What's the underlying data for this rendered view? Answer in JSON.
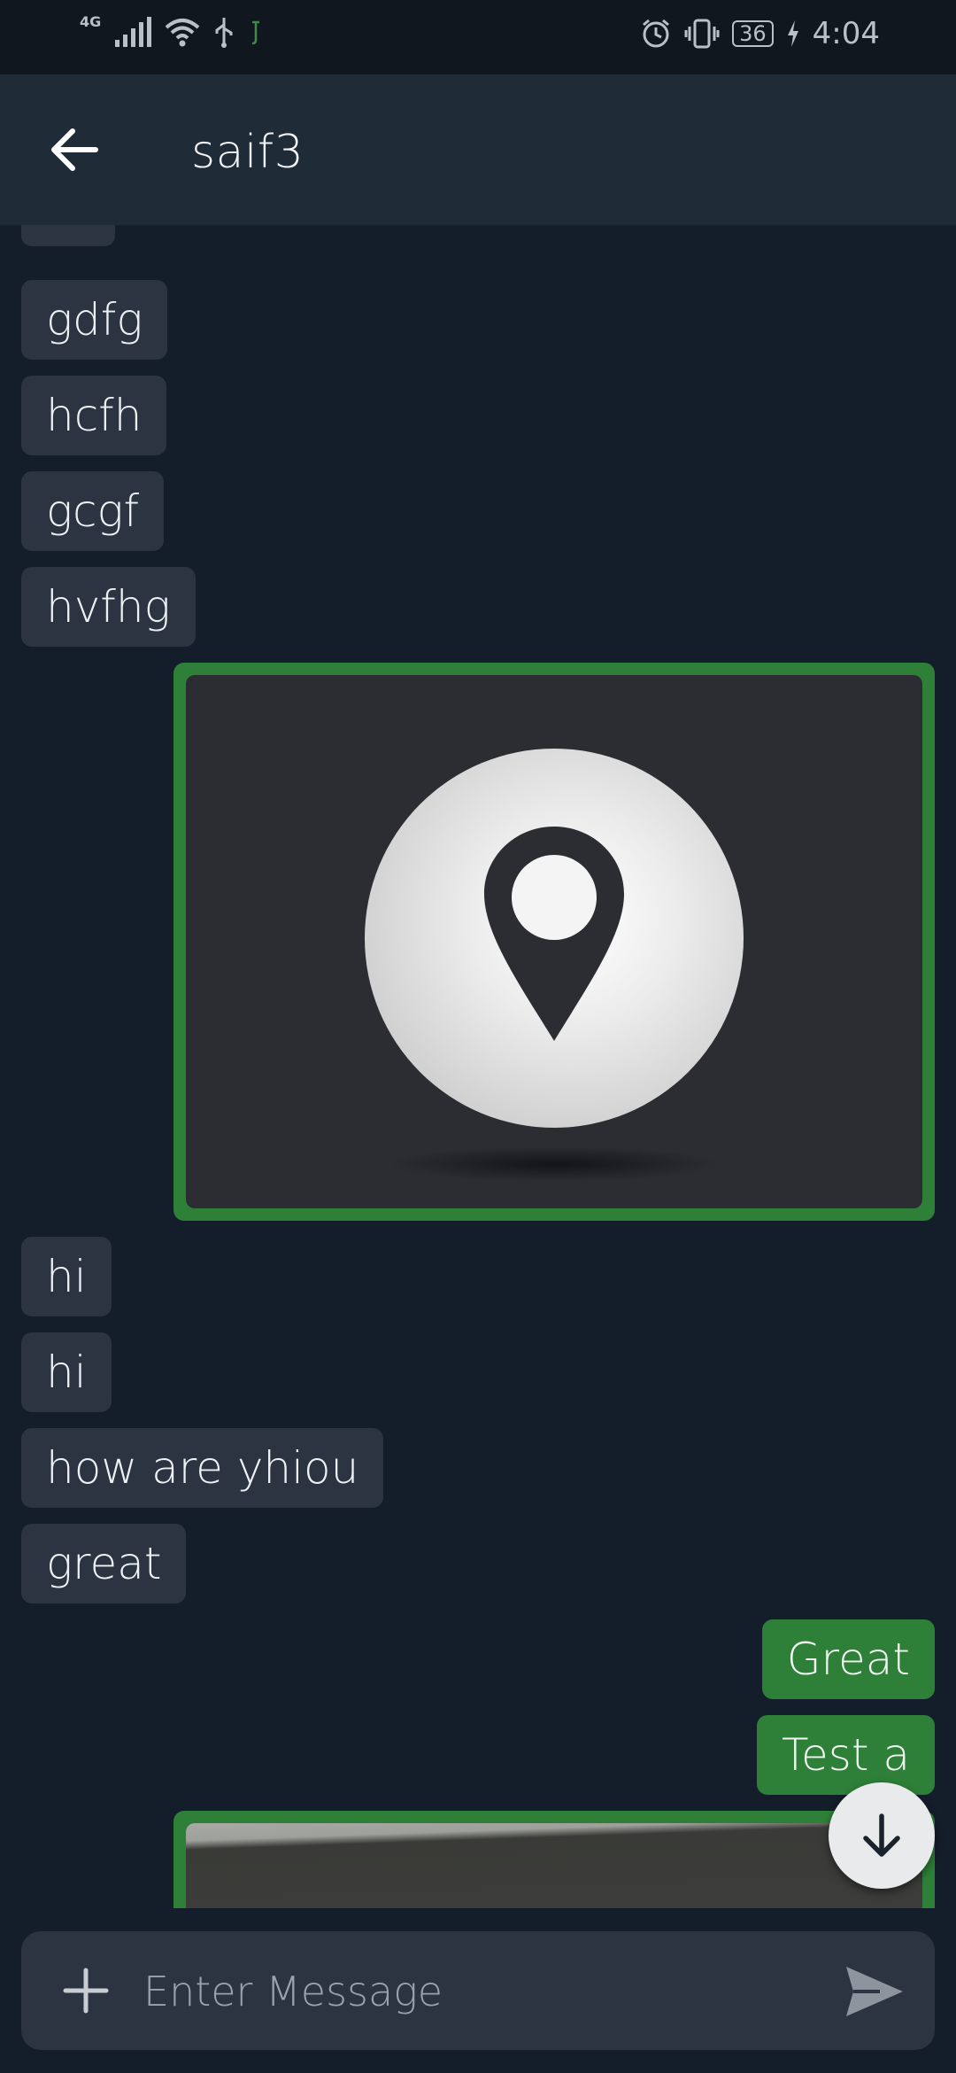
{
  "status_bar": {
    "network": "4G",
    "battery": "36",
    "time": "4:04"
  },
  "header": {
    "title": "saif3"
  },
  "messages": [
    {
      "type": "text",
      "direction": "received",
      "text": "gdfg"
    },
    {
      "type": "text",
      "direction": "received",
      "text": "hcfh"
    },
    {
      "type": "text",
      "direction": "received",
      "text": "gcgf"
    },
    {
      "type": "text",
      "direction": "received",
      "text": "hvfhg"
    },
    {
      "type": "location",
      "direction": "sent",
      "icon": "map-pin-icon"
    },
    {
      "type": "text",
      "direction": "received",
      "text": "hi"
    },
    {
      "type": "text",
      "direction": "received",
      "text": " hi"
    },
    {
      "type": "text",
      "direction": "received",
      "text": "how are yhiou"
    },
    {
      "type": "text",
      "direction": "received",
      "text": "great"
    },
    {
      "type": "text",
      "direction": "sent",
      "text": "Great"
    },
    {
      "type": "text",
      "direction": "sent",
      "text": "Test a"
    },
    {
      "type": "image",
      "direction": "sent"
    }
  ],
  "composer": {
    "placeholder": "Enter Message",
    "value": ""
  },
  "colors": {
    "background": "#141d2a",
    "app_bar": "#1f2b37",
    "received_bubble": "#2b3440",
    "sent_bubble": "#2e8038",
    "fab": "#e9eaec"
  },
  "icons": {
    "back": "arrow-left-icon",
    "scroll_down": "arrow-down-icon",
    "attach": "plus-icon",
    "send": "send-icon"
  }
}
